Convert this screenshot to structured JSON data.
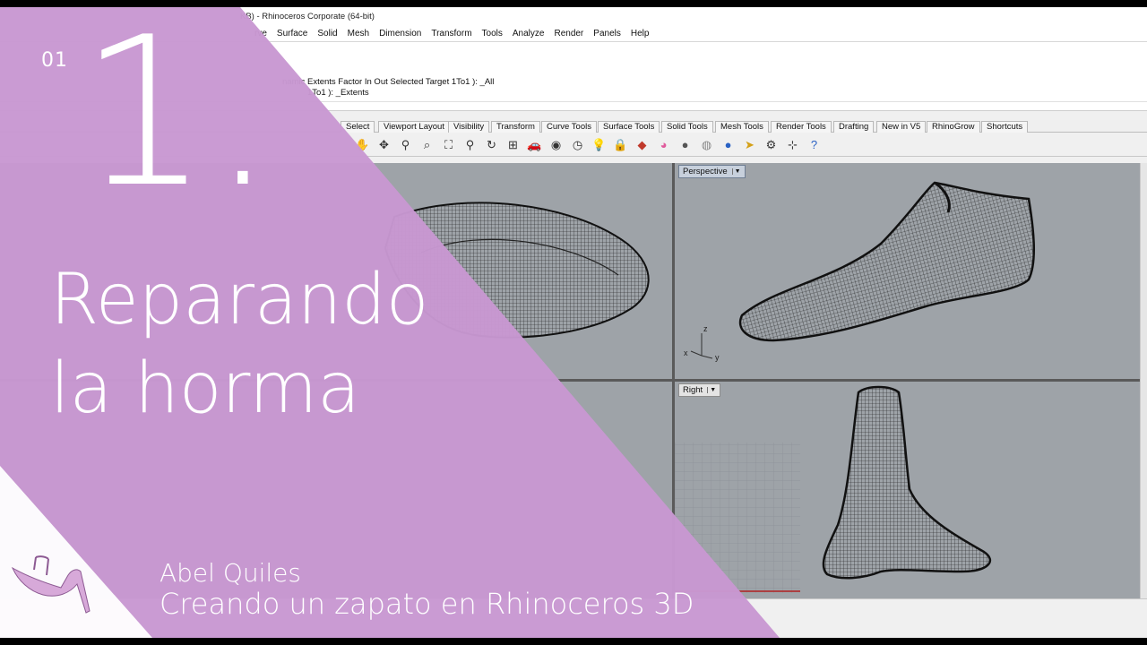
{
  "window": {
    "title": "KB) - Rhinoceros Corporate (64-bit)"
  },
  "menu": [
    "rve",
    "Surface",
    "Solid",
    "Mesh",
    "Dimension",
    "Transform",
    "Tools",
    "Analyze",
    "Render",
    "Panels",
    "Help"
  ],
  "command_history": {
    "line1": "namic  Extents  Factor  In  Out  Selected  Target  1To1 ): _All",
    "line2": "1To1 ): _Extents"
  },
  "toolbar_tabs": [
    "Select",
    "Viewport Layout",
    "Visibility",
    "Transform",
    "Curve Tools",
    "Surface Tools",
    "Solid Tools",
    "Mesh Tools",
    "Render Tools",
    "Drafting",
    "New in V5",
    "RhinoGrow",
    "Shortcuts"
  ],
  "toolbar_icons": [
    "pan-hand-icon",
    "rotate-view-icon",
    "zoom-dynamic-icon",
    "zoom-window-icon",
    "zoom-extents-icon",
    "zoom-selected-icon",
    "rotate-3d-icon",
    "four-viewports-icon",
    "car-icon",
    "camera-icon",
    "clock-icon",
    "light-bulb-icon",
    "lock-icon",
    "layer-icon",
    "color-wheel-icon",
    "sphere-icon",
    "shaded-sphere-icon",
    "render-sphere-icon",
    "arrow-cursor-icon",
    "gear-icon",
    "gumball-icon",
    "help-icon"
  ],
  "viewports": {
    "top_left": {
      "label": ""
    },
    "perspective": {
      "label": "Perspective"
    },
    "bottom_left": {
      "label": ""
    },
    "right": {
      "label": "Right"
    }
  },
  "axes": {
    "z": "z",
    "x": "x",
    "y": "y"
  },
  "colors": {
    "overlay": "#c898d2",
    "viewport_bg": "#9ea3a8",
    "active_tab": "#c7d0dc"
  },
  "overlay": {
    "episode_number": "01",
    "big_number": "1.",
    "title_line1": "Reparando",
    "title_line2": "la horma",
    "author": "Abel Quiles",
    "course": "Creando un zapato en Rhinoceros 3D"
  }
}
